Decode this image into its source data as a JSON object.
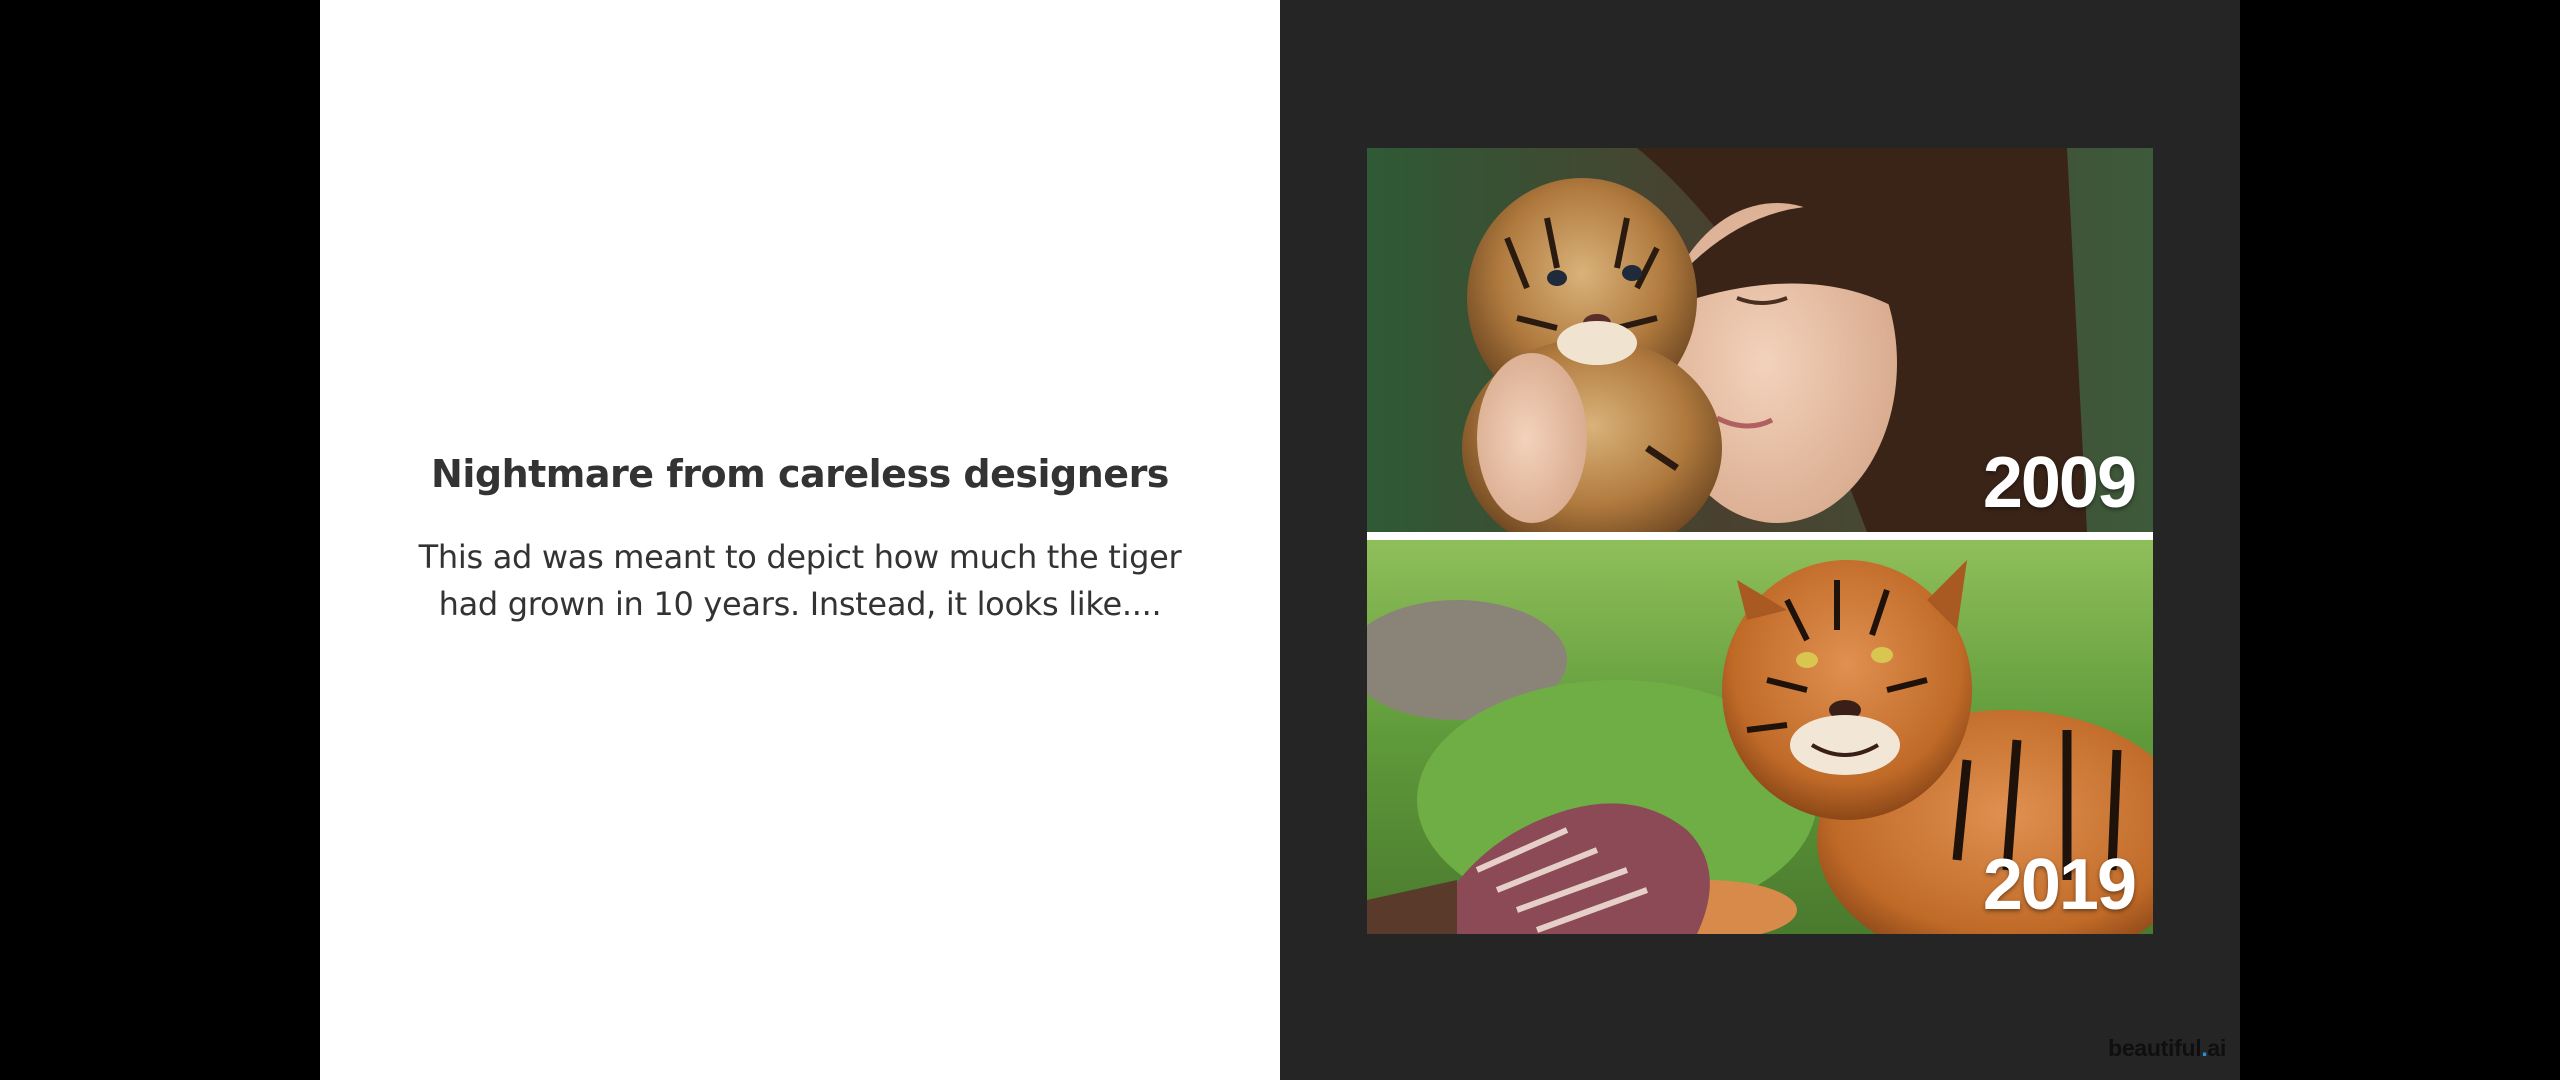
{
  "slide": {
    "title": "Nightmare from careless designers",
    "body": "This ad was meant to depict how much the tiger had grown in 10 years. Instead, it looks like...."
  },
  "photos": [
    {
      "year": "2009",
      "icon": "tiger-cub-with-woman-photo"
    },
    {
      "year": "2019",
      "icon": "adult-tiger-eating-carcass-photo"
    }
  ],
  "brand": {
    "logo_text": "beautiful.ai",
    "logo_part1": "beautiful",
    "logo_dot": ".",
    "logo_part2": "ai",
    "accent": "#2a8fd6"
  },
  "colors": {
    "left_bg": "#ffffff",
    "right_bg": "#252525",
    "outer_bg": "#000000",
    "text": "#333333"
  }
}
